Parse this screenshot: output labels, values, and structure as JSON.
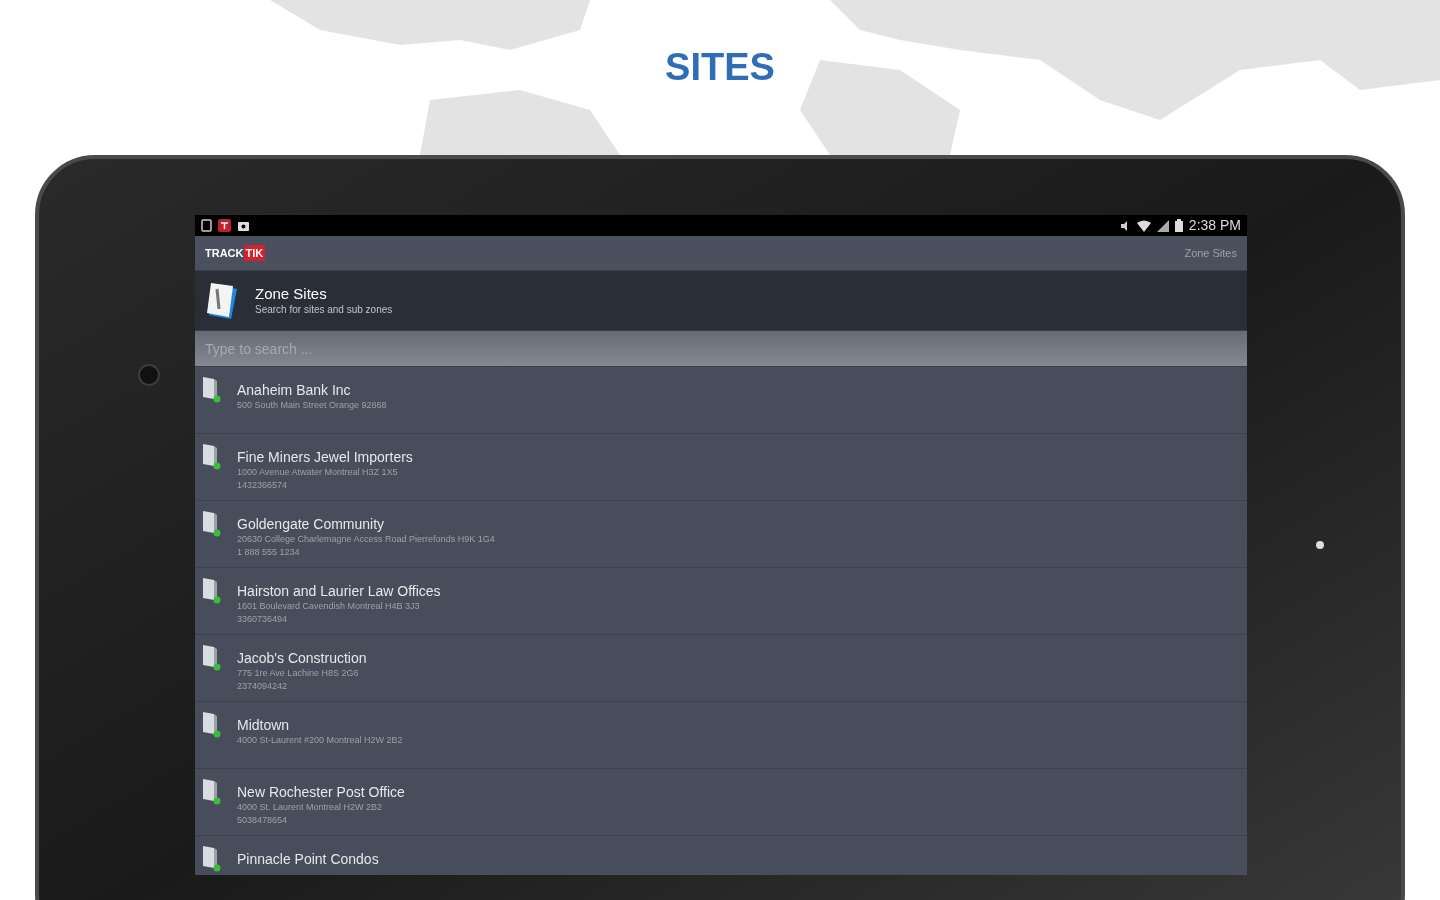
{
  "page_title": "SITES",
  "status_bar": {
    "time": "2:38 PM"
  },
  "action_bar": {
    "logo_left": "TRACK",
    "logo_right": "TIK",
    "title": "Zone Sites"
  },
  "header": {
    "title": "Zone Sites",
    "subtitle": "Search for sites and sub zones"
  },
  "search": {
    "placeholder": "Type to search ..."
  },
  "sites": [
    {
      "name": "Anaheim Bank Inc",
      "address": "500 South Main Street Orange 92868"
    },
    {
      "name": "Fine Miners Jewel Importers",
      "address": "1000 Avenue Atwater Montreal H3Z 1X5",
      "phone": "1432366574"
    },
    {
      "name": "Goldengate Community",
      "address": "20630 College Charlemagne Access Road Pierrefonds H9K 1G4",
      "phone": "1 888 555 1234"
    },
    {
      "name": "Hairston and Laurier Law Offices",
      "address": "1601 Boulevard Cavendish Montreal H4B 3J3",
      "phone": "3360736494"
    },
    {
      "name": "Jacob's Construction",
      "address": "775 1re Ave Lachine H8S 2G6",
      "phone": "2374094242"
    },
    {
      "name": "Midtown",
      "address": "4000 St-Laurent #200 Montreal H2W 2B2"
    },
    {
      "name": "New Rochester Post Office",
      "address": "4000 St. Laurent Montreal H2W 2B2",
      "phone": "5038478654"
    },
    {
      "name": "Pinnacle Point Condos"
    }
  ]
}
